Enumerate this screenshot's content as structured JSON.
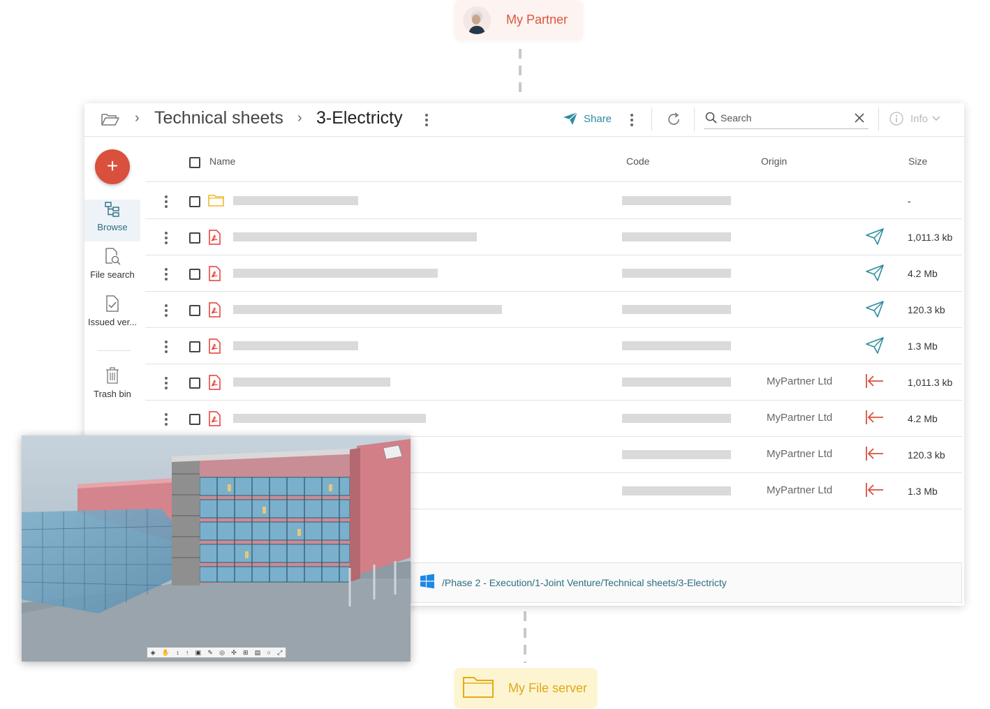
{
  "partner": {
    "label": "My Partner"
  },
  "file_server": {
    "label": "My File server"
  },
  "toolbar": {
    "breadcrumb": [
      "Technical sheets",
      "3-Electricty"
    ],
    "share_label": "Share",
    "search_placeholder": "Search",
    "info_label": "Info"
  },
  "sidebar": {
    "add_label": "+",
    "items": [
      {
        "label": "Browse",
        "icon": "browse-tree-icon",
        "active": true
      },
      {
        "label": "File search",
        "icon": "file-search-icon",
        "active": false
      },
      {
        "label": "Issued ver...",
        "icon": "issued-version-icon",
        "active": false
      },
      {
        "label": "Trash bin",
        "icon": "trash-icon",
        "active": false
      }
    ]
  },
  "table": {
    "columns": [
      "Name",
      "Code",
      "Origin",
      "Size"
    ],
    "rows": [
      {
        "type": "folder",
        "origin": "",
        "origin_icon": "",
        "size": "-"
      },
      {
        "type": "pdf",
        "origin": "",
        "origin_icon": "send-icon",
        "size": "1,011.3 kb"
      },
      {
        "type": "pdf",
        "origin": "",
        "origin_icon": "send-icon",
        "size": "4.2 Mb"
      },
      {
        "type": "pdf",
        "origin": "",
        "origin_icon": "send-icon",
        "size": "120.3 kb"
      },
      {
        "type": "pdf",
        "origin": "",
        "origin_icon": "send-icon",
        "size": "1.3 Mb"
      },
      {
        "type": "pdf",
        "origin": "MyPartner Ltd",
        "origin_icon": "received-icon",
        "size": "1,011.3 kb"
      },
      {
        "type": "pdf",
        "origin": "MyPartner Ltd",
        "origin_icon": "received-icon",
        "size": "4.2 Mb"
      },
      {
        "type": "pdf",
        "origin": "MyPartner Ltd",
        "origin_icon": "received-icon",
        "size": "120.3 kb"
      },
      {
        "type": "pdf",
        "origin": "MyPartner Ltd",
        "origin_icon": "received-icon",
        "size": "1.3 Mb"
      }
    ]
  },
  "path_bar": {
    "path": "/Phase 2 - Execution/1-Joint Venture/Technical sheets/3-Electricty"
  },
  "colors": {
    "accent": "#2d8aa0",
    "fab": "#d9503c",
    "received": "#d9503c",
    "folder": "#f2b824",
    "pdf": "#e53935"
  }
}
